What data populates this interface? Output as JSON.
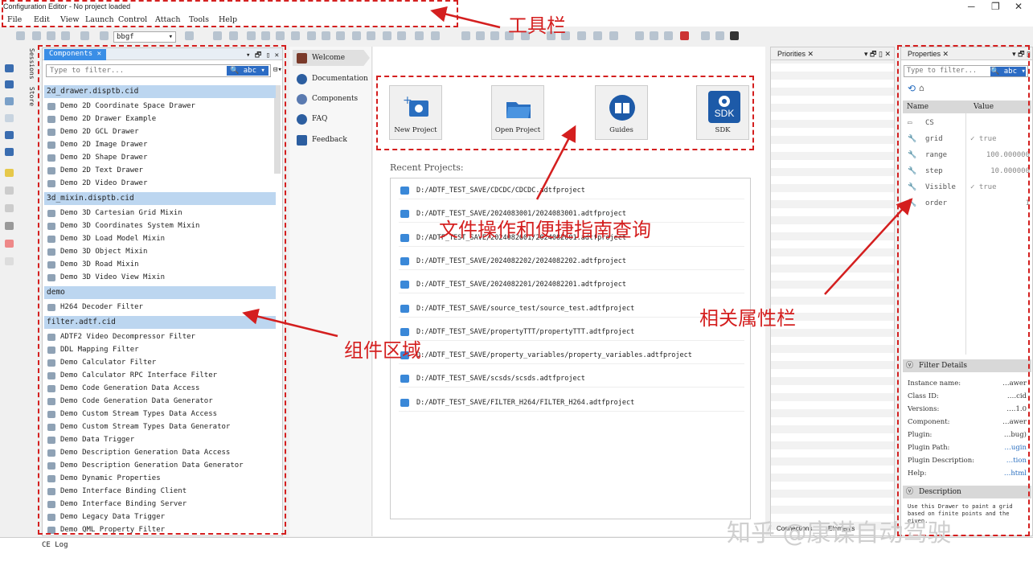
{
  "window": {
    "title": "Configuration Editor - No project loaded",
    "min": "─",
    "max": "❐",
    "close": "✕"
  },
  "menu": [
    "File",
    "Edit",
    "View",
    "Launch",
    "Control",
    "Attach",
    "Tools",
    "Help"
  ],
  "toolbar": {
    "combo_value": "bbgf"
  },
  "sidebar_tabs": [
    "Sessions",
    "Store"
  ],
  "components": {
    "tab": "Components",
    "filter_placeholder": "Type to filter...",
    "filter_button": "abc",
    "groups": [
      {
        "name": "2d_drawer.disptb.cid",
        "items": [
          "Demo 2D Coordinate Space Drawer",
          "Demo 2D Drawer Example",
          "Demo 2D GCL Drawer",
          "Demo 2D Image Drawer",
          "Demo 2D Shape Drawer",
          "Demo 2D Text Drawer",
          "Demo 2D Video Drawer"
        ]
      },
      {
        "name": "3d_mixin.disptb.cid",
        "items": [
          "Demo 3D Cartesian Grid Mixin",
          "Demo 3D Coordinates System Mixin",
          "Demo 3D Load Model Mixin",
          "Demo 3D Object Mixin",
          "Demo 3D Road Mixin",
          "Demo 3D Video View Mixin"
        ]
      },
      {
        "name": "demo",
        "items": [
          "H264 Decoder Filter"
        ]
      },
      {
        "name": "filter.adtf.cid",
        "items": [
          "ADTF2 Video Decompressor Filter",
          "DDL Mapping Filter",
          "Demo Calculator Filter",
          "Demo Calculator RPC Interface Filter",
          "Demo Code Generation Data Access",
          "Demo Code Generation Data Generator",
          "Demo Custom Stream Types Data Access",
          "Demo Custom Stream Types Data Generator",
          "Demo Data Trigger",
          "Demo Description Generation Data Access",
          "Demo Description Generation Data Generator",
          "Demo Dynamic Properties",
          "Demo Interface Binding Client",
          "Demo Interface Binding Server",
          "Demo Legacy Data Trigger",
          "Demo QML Property Filter"
        ]
      }
    ]
  },
  "welcome_nav": [
    "Welcome",
    "Documentation",
    "Components",
    "FAQ",
    "Feedback"
  ],
  "quick_buttons": [
    "New Project",
    "Open Project",
    "Guides",
    "SDK"
  ],
  "sdk_icon_text": "SDK",
  "recent": {
    "title": "Recent Projects:",
    "items": [
      "D:/ADTF_TEST_SAVE/CDCDC/CDCDC.adtfproject",
      "D:/ADTF_TEST_SAVE/2024083001/2024083001.adtfproject",
      "D:/ADTF_TEST_SAVE/2024082601/2024082601.adtfproject",
      "D:/ADTF_TEST_SAVE/2024082202/2024082202.adtfproject",
      "D:/ADTF_TEST_SAVE/2024082201/2024082201.adtfproject",
      "D:/ADTF_TEST_SAVE/source_test/source_test.adtfproject",
      "D:/ADTF_TEST_SAVE/propertyTTT/propertyTTT.adtfproject",
      "D:/ADTF_TEST_SAVE/property_variables/property_variables.adtfproject",
      "D:/ADTF_TEST_SAVE/scsds/scsds.adtfproject",
      "D:/ADTF_TEST_SAVE/FILTER_H264/FILTER_H264.adtfproject"
    ]
  },
  "priorities": {
    "tab": "Priorities"
  },
  "properties": {
    "tab": "Properties",
    "filter_placeholder": "Type to filter...",
    "filter_button": "abc",
    "col_name": "Name",
    "col_value": "Value",
    "rows": [
      {
        "name": "CS",
        "value": ""
      },
      {
        "name": "grid",
        "value": "✓ true"
      },
      {
        "name": "range",
        "value": "100.000000"
      },
      {
        "name": "step",
        "value": "10.000000"
      },
      {
        "name": "Visible",
        "value": "✓ true"
      },
      {
        "name": "order",
        "value": "1"
      }
    ],
    "filter_details_title": "Filter Details",
    "details": [
      {
        "k": "Instance name:",
        "v": "…awer"
      },
      {
        "k": "Class ID:",
        "v": "….cid"
      },
      {
        "k": "Versions:",
        "v": "….1.0"
      },
      {
        "k": "Component:",
        "v": "…awer"
      },
      {
        "k": "Plugin:",
        "v": "…bug)"
      },
      {
        "k": "Plugin Path:",
        "v": "…ugin"
      },
      {
        "k": "Plugin Description:",
        "v": "…tion"
      },
      {
        "k": "Help:",
        "v": "…html"
      }
    ],
    "description_title": "Description",
    "description_text": "Use this Drawer to paint a grid based on finite points and the given..."
  },
  "bottom_tabs": {
    "connections": "Connections",
    "elements": "Elements",
    "log": "CE Log"
  },
  "annotations": {
    "toolbar": "工具栏",
    "file_ops": "文件操作和便捷指南查询",
    "components": "组件区域",
    "properties": "相关属性栏"
  },
  "watermark": "知乎 @康谋自动驾驶",
  "colors": {
    "annotation": "#d41f1f",
    "accent": "#3a8ee6",
    "group_bg": "#bcd6f0"
  }
}
